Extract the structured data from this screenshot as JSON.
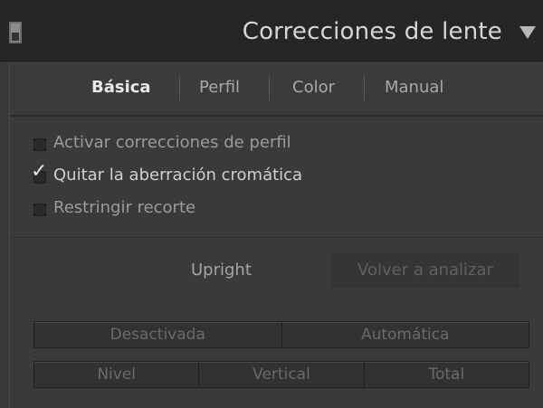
{
  "panel": {
    "title": "Correcciones de lente"
  },
  "tabs": [
    {
      "label": "Básica",
      "active": true
    },
    {
      "label": "Perfil",
      "active": false
    },
    {
      "label": "Color",
      "active": false
    },
    {
      "label": "Manual",
      "active": false
    }
  ],
  "checkboxes": [
    {
      "label": "Activar correcciones de perfil",
      "checked": false
    },
    {
      "label": "Quitar la aberración cromática",
      "checked": true
    },
    {
      "label": "Restringir recorte",
      "checked": false
    }
  ],
  "upright": {
    "label": "Upright",
    "reanalyze_label": "Volver a analizar",
    "mode_buttons": [
      "Desactivada",
      "Automática"
    ],
    "axis_buttons": [
      "Nivel",
      "Vertical",
      "Total"
    ]
  },
  "colors": {
    "background": "#3a3a3a",
    "header": "#262626",
    "text_active": "#e8e8e8",
    "text_muted": "#9b9b9b"
  },
  "icons": {
    "collapse": "panel-switch-icon",
    "expand": "triangle-down-icon",
    "check": "checkmark-icon"
  }
}
